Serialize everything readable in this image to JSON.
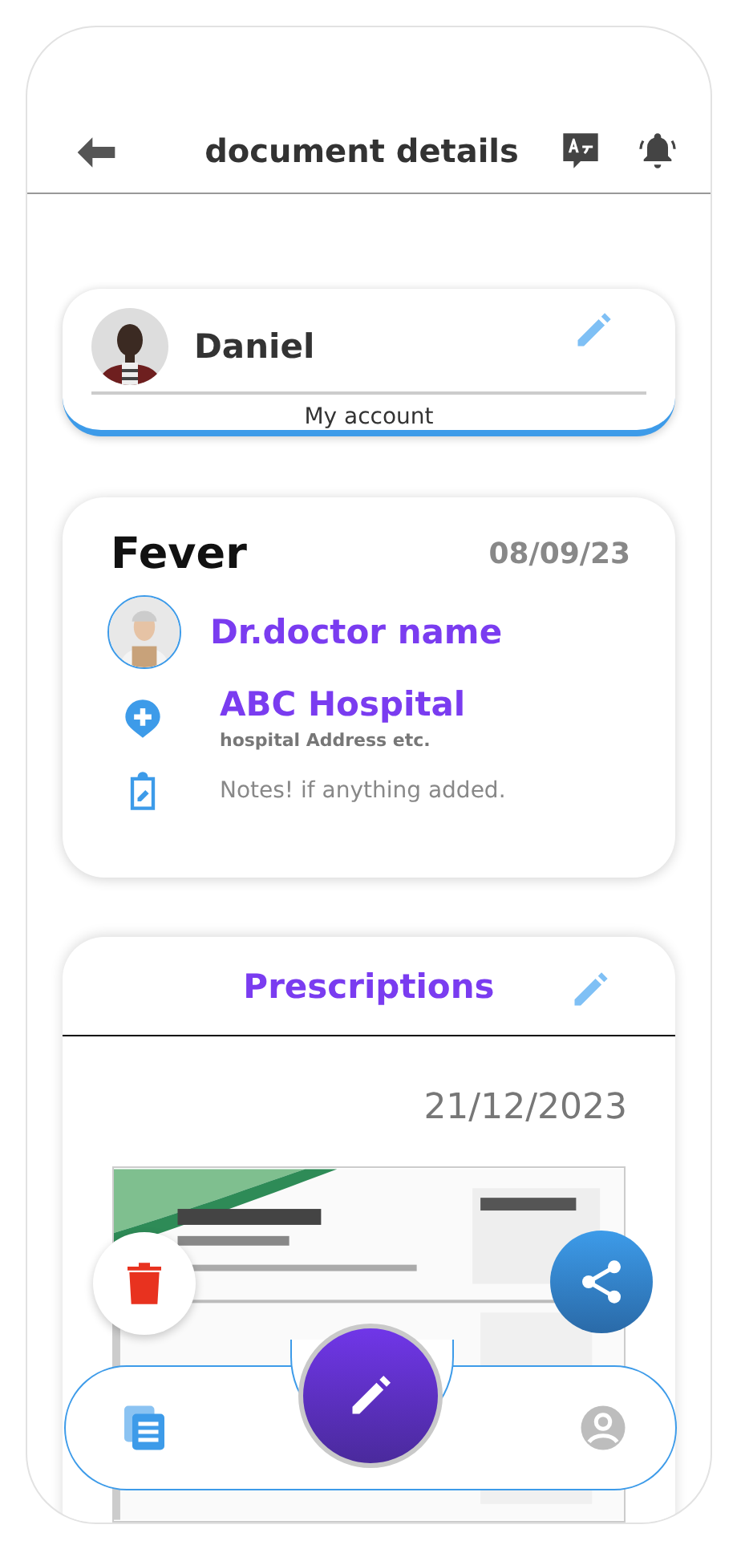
{
  "header": {
    "title": "document details"
  },
  "account": {
    "name": "Daniel",
    "subtitle": "My account"
  },
  "visit": {
    "title": "Fever",
    "date": "08/09/23",
    "doctor": "Dr.doctor name",
    "hospital": "ABC Hospital",
    "address": "hospital Address etc.",
    "notes": "Notes! if anything added."
  },
  "prescriptions": {
    "title": "Prescriptions",
    "date": "21/12/2023"
  },
  "bottom_nav": [
    {
      "kind": "documents",
      "selected": true
    },
    {
      "kind": "profile",
      "selected": false
    }
  ]
}
